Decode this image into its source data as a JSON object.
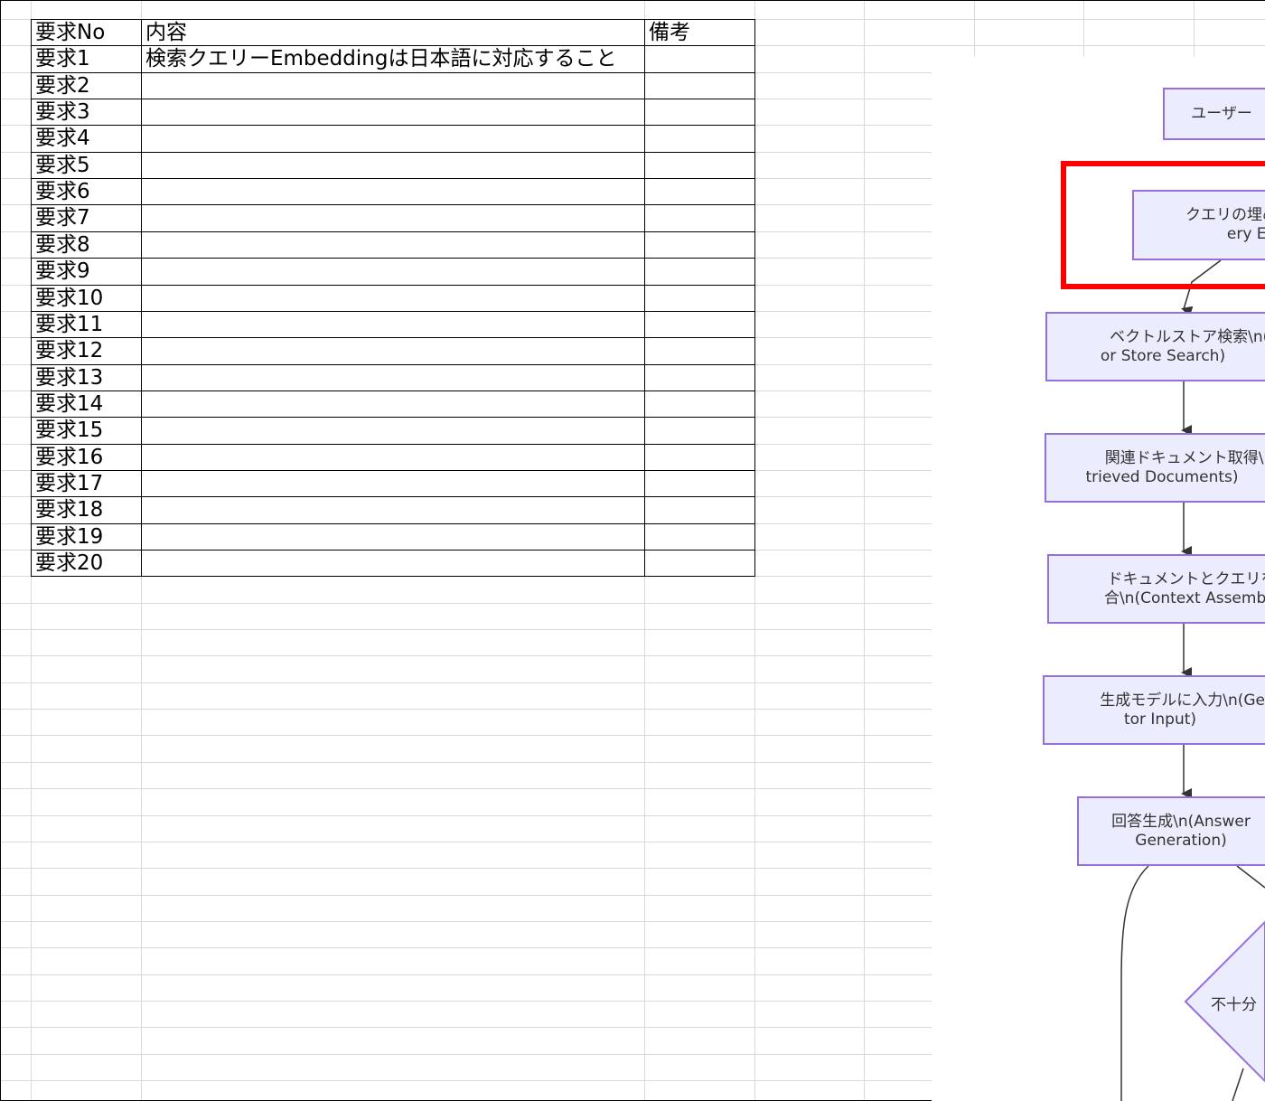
{
  "table": {
    "headers": [
      "要求No",
      "内容",
      "備考"
    ],
    "rows": [
      {
        "no": "要求1",
        "content": "検索クエリーEmbeddingは日本語に対応すること",
        "note": ""
      },
      {
        "no": "要求2",
        "content": "",
        "note": ""
      },
      {
        "no": "要求3",
        "content": "",
        "note": ""
      },
      {
        "no": "要求4",
        "content": "",
        "note": ""
      },
      {
        "no": "要求5",
        "content": "",
        "note": ""
      },
      {
        "no": "要求6",
        "content": "",
        "note": ""
      },
      {
        "no": "要求7",
        "content": "",
        "note": ""
      },
      {
        "no": "要求8",
        "content": "",
        "note": ""
      },
      {
        "no": "要求9",
        "content": "",
        "note": ""
      },
      {
        "no": "要求10",
        "content": "",
        "note": ""
      },
      {
        "no": "要求11",
        "content": "",
        "note": ""
      },
      {
        "no": "要求12",
        "content": "",
        "note": ""
      },
      {
        "no": "要求13",
        "content": "",
        "note": ""
      },
      {
        "no": "要求14",
        "content": "",
        "note": ""
      },
      {
        "no": "要求15",
        "content": "",
        "note": ""
      },
      {
        "no": "要求16",
        "content": "",
        "note": ""
      },
      {
        "no": "要求17",
        "content": "",
        "note": ""
      },
      {
        "no": "要求18",
        "content": "",
        "note": ""
      },
      {
        "no": "要求19",
        "content": "",
        "note": ""
      },
      {
        "no": "要求20",
        "content": "",
        "note": ""
      }
    ]
  },
  "flowchart": {
    "nodes": [
      {
        "id": "user",
        "lines": [
          "ユーザー"
        ]
      },
      {
        "id": "embed",
        "lines": [
          "クエリの埋め",
          "ery Em"
        ]
      },
      {
        "id": "vector",
        "lines": [
          "ベクトルストア検索\\n(V",
          "or Store Search)"
        ]
      },
      {
        "id": "retrieve",
        "lines": [
          "関連ドキュメント取得\\n",
          "trieved Documents)"
        ]
      },
      {
        "id": "context",
        "lines": [
          "ドキュメントとクエリを",
          "合\\n(Context Assembly"
        ]
      },
      {
        "id": "genin",
        "lines": [
          "生成モデルに入力\\n(Gen",
          "tor Input)"
        ]
      },
      {
        "id": "answer",
        "lines": [
          "回答生成\\n(Answer",
          "Generation)"
        ]
      },
      {
        "id": "decision",
        "lines": [
          "不十分"
        ]
      }
    ],
    "colors": {
      "node_fill": "#ececff",
      "node_border": "#9370db",
      "edge": "#333333",
      "highlight": "#ff0000"
    }
  }
}
